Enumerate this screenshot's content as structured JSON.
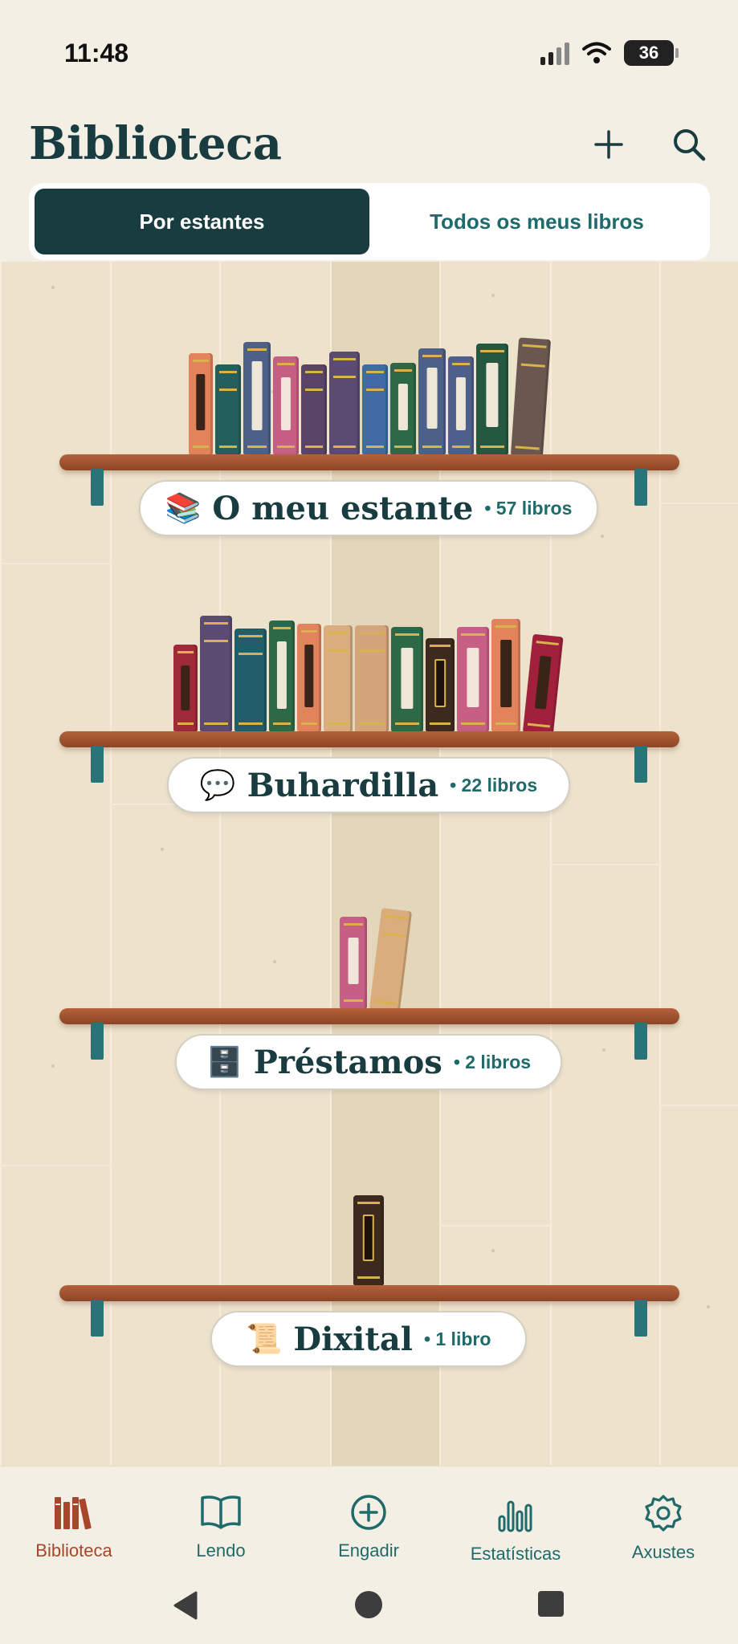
{
  "status_bar": {
    "time": "11:48",
    "battery": "36"
  },
  "header": {
    "title": "Biblioteca",
    "add_icon": "plus-icon",
    "search_icon": "search-icon"
  },
  "tabs": [
    {
      "label": "Por estantes",
      "active": true
    },
    {
      "label": "Todos os meus libros",
      "active": false
    }
  ],
  "shelves": [
    {
      "emoji": "📚",
      "name": "O meu estante",
      "count": "• 57 libros"
    },
    {
      "emoji": "💬",
      "name": "Buhardilla",
      "count": "• 22 libros"
    },
    {
      "emoji": "🗄️",
      "name": "Préstamos",
      "count": "• 2 libros"
    },
    {
      "emoji": "📜",
      "name": "Dixital",
      "count": "• 1 libro"
    }
  ],
  "bottom_nav": [
    {
      "label": "Biblioteca",
      "icon": "library-icon",
      "active": true
    },
    {
      "label": "Lendo",
      "icon": "open-book-icon",
      "active": false
    },
    {
      "label": "Engadir",
      "icon": "add-circle-icon",
      "active": false
    },
    {
      "label": "Estatísticas",
      "icon": "bar-chart-icon",
      "active": false
    },
    {
      "label": "Axustes",
      "icon": "gear-icon",
      "active": false
    }
  ],
  "colors": {
    "primary": "#183c3f",
    "accent_teal": "#1f6a6a",
    "active_nav": "#a8462b",
    "background": "#f4efe5",
    "shelf_wood": "#a0502e"
  }
}
